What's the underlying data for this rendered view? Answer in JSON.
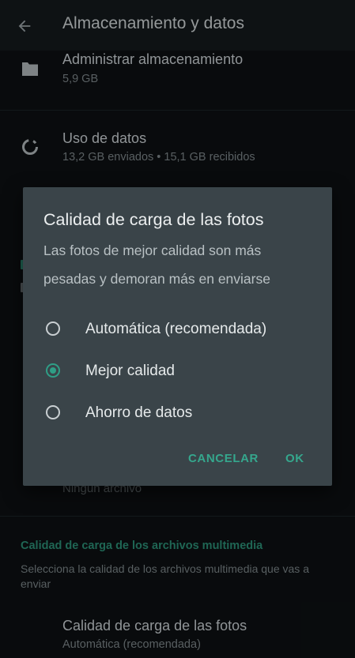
{
  "appbar": {
    "title": "Almacenamiento y datos",
    "back_icon": "arrow-left-icon"
  },
  "storage": {
    "title": "Administrar almacenamiento",
    "subtitle": "5,9 GB",
    "icon": "folder-icon"
  },
  "data_usage": {
    "title": "Uso de datos",
    "subtitle": "13,2 GB enviados • 15,1 GB recibidos",
    "icon": "data-usage-icon"
  },
  "obscured_row": {
    "subtitle": "Ningún archivo"
  },
  "media_quality": {
    "header": "Calidad de carga de los archivos multimedia",
    "description": "Selecciona la calidad de los archivos multimedia que vas a enviar",
    "photo_row": {
      "title": "Calidad de carga de las fotos",
      "subtitle": "Automática (recomendada)"
    }
  },
  "dialog": {
    "title": "Calidad de carga de las fotos",
    "message": "Las fotos de mejor calidad son más pesadas y demoran más en enviarse",
    "selected_option": "Mejor calidad",
    "options": [
      {
        "label": "Automática (recomendada)",
        "selected": false
      },
      {
        "label": "Mejor calidad",
        "selected": true
      },
      {
        "label": "Ahorro de datos",
        "selected": false
      }
    ],
    "cancel_label": "CANCELAR",
    "ok_label": "OK"
  },
  "colors": {
    "background": "#0d1113",
    "appbar": "#151b1e",
    "dialog": "#3a4449",
    "accent": "#2f9e86"
  }
}
